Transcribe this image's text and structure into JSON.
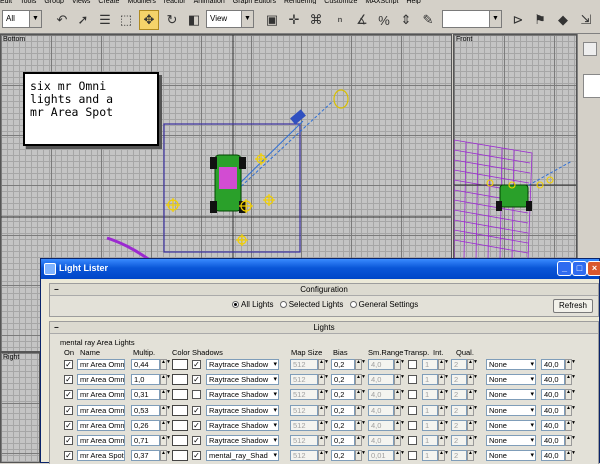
{
  "menubar": {
    "items": [
      "Edit",
      "Tools",
      "Group",
      "Views",
      "Create",
      "Modifiers",
      "reactor",
      "Animation",
      "Graph Editors",
      "Rendering",
      "Customize",
      "MAXScript",
      "Help"
    ]
  },
  "toolbar": {
    "selection_filter": "All",
    "ref_coord": "View",
    "icons": [
      "undo-icon",
      "select-icon",
      "select-by-name-icon",
      "region-select-icon",
      "move-icon",
      "rotate-icon",
      "scale-icon",
      "pivot-icon",
      "angle-snap-icon",
      "percent-snap-icon",
      "spinner-snap-icon",
      "mirror-icon",
      "align-icon",
      "render-icon"
    ]
  },
  "viewports": {
    "bottom_label": "Bottom",
    "front_label": "Front",
    "right_label": "Right"
  },
  "callout": {
    "text": "six mr Omni\nlights and a\nmr Area Spot"
  },
  "window": {
    "title": "Light Lister",
    "config_section": "Configuration",
    "options": [
      "All Lights",
      "Selected Lights",
      "General Settings"
    ],
    "selected_option": "All Lights",
    "refresh_label": "Refresh",
    "lights_section": "Lights",
    "group_label": "mental ray Area Lights",
    "columns": {
      "on": "On",
      "name": "Name",
      "multiplier": "Multip.",
      "color": "Color",
      "shadows": "Shadows",
      "map_size": "Map Size",
      "bias": "Bias",
      "sm_range": "Sm.Range",
      "transp": "Transp.",
      "int": "Int.",
      "qual": "Qual."
    },
    "rows": [
      {
        "name": "mr Area Omni",
        "mult": "0,44",
        "shadow_on": true,
        "shadow": "Raytrace Shadow",
        "map": "512",
        "bias": "0,2",
        "range": "4,0",
        "int": "1",
        "qual": "2",
        "decay": "None",
        "dist": "40,0"
      },
      {
        "name": "mr Area Omni",
        "mult": "1,0",
        "shadow_on": true,
        "shadow": "Raytrace Shadow",
        "map": "512",
        "bias": "0,2",
        "range": "4,0",
        "int": "1",
        "qual": "2",
        "decay": "None",
        "dist": "40,0"
      },
      {
        "name": "mr Area Omni",
        "mult": "0,31",
        "shadow_on": false,
        "shadow": "Raytrace Shadow",
        "map": "512",
        "bias": "0,2",
        "range": "4,0",
        "int": "1",
        "qual": "2",
        "decay": "None",
        "dist": "40,0"
      },
      {
        "name": "mr Area Omni",
        "mult": "0,53",
        "shadow_on": true,
        "shadow": "Raytrace Shadow",
        "map": "512",
        "bias": "0,2",
        "range": "4,0",
        "int": "1",
        "qual": "2",
        "decay": "None",
        "dist": "40,0"
      },
      {
        "name": "mr Area Omni",
        "mult": "0,26",
        "shadow_on": true,
        "shadow": "Raytrace Shadow",
        "map": "512",
        "bias": "0,2",
        "range": "4,0",
        "int": "1",
        "qual": "2",
        "decay": "None",
        "dist": "40,0"
      },
      {
        "name": "mr Area Omni",
        "mult": "0,71",
        "shadow_on": true,
        "shadow": "Raytrace Shadow",
        "map": "512",
        "bias": "0,2",
        "range": "4,0",
        "int": "1",
        "qual": "2",
        "decay": "None",
        "dist": "40,0"
      },
      {
        "name": "mr Area Spot",
        "mult": "0,37",
        "shadow_on": true,
        "shadow": "mental_ray_Shad",
        "map": "512",
        "bias": "0,2",
        "range": "0,01",
        "int": "1",
        "qual": "2",
        "decay": "None",
        "dist": "40,0"
      }
    ]
  },
  "colors": {
    "title_bar": "#0a56d8",
    "active_tool": "#f5d36a",
    "grid": "#c4c4c4",
    "light_gizmo": "#f2d000",
    "selection_cyan": "#2e6fd6",
    "wire_purple": "#9b2ad0"
  }
}
